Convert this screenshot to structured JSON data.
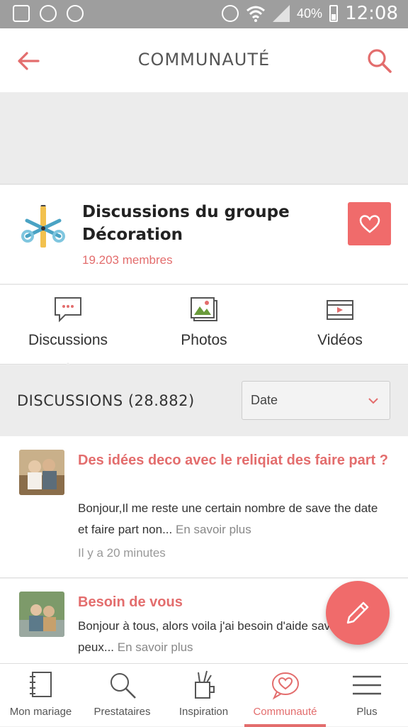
{
  "status_bar": {
    "battery": "40%",
    "time": "12:08"
  },
  "header": {
    "title": "COMMUNAUTÉ"
  },
  "group": {
    "name": "Discussions du groupe Décoration",
    "members": "19.203 membres"
  },
  "tabs": [
    {
      "label": "Discussions",
      "icon": "chat-bubble-icon"
    },
    {
      "label": "Photos",
      "icon": "photos-icon"
    },
    {
      "label": "Vidéos",
      "icon": "video-icon"
    }
  ],
  "discussions": {
    "heading": "DISCUSSIONS (28.882)",
    "sort_value": "Date",
    "posts": [
      {
        "title": "Des idées deco avec le reliqiat des faire part ?",
        "excerpt": "Bonjour,Il me reste une certain nombre de save the date et faire part non...",
        "more": "En savoir plus",
        "time": "Il y a 20 minutes"
      },
      {
        "title": "Besoin de vous",
        "excerpt": "Bonjour à tous, alors voila j'ai besoin d'aide savoir ou je peux...",
        "more": "En savoir plus",
        "time": ""
      }
    ]
  },
  "bottom_nav": [
    {
      "label": "Mon mariage",
      "icon": "notebook-icon"
    },
    {
      "label": "Prestataires",
      "icon": "search-icon"
    },
    {
      "label": "Inspiration",
      "icon": "pencil-cup-icon"
    },
    {
      "label": "Communauté",
      "icon": "heart-chat-icon",
      "active": true
    },
    {
      "label": "Plus",
      "icon": "menu-icon"
    }
  ],
  "colors": {
    "accent": "#e36d6d",
    "fab": "#f06b6b"
  }
}
